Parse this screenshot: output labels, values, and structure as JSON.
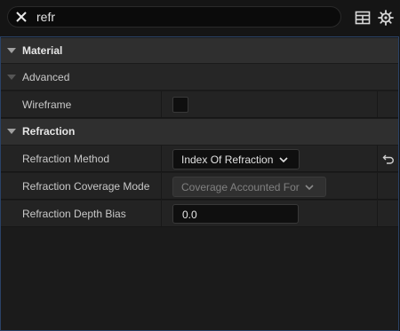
{
  "search": {
    "value": "refr"
  },
  "toolbar": {
    "view_options_icon": "table-grid-icon",
    "settings_icon": "gear-icon"
  },
  "categories": [
    {
      "label": "Material",
      "subcategory": {
        "label": "Advanced"
      },
      "properties": [
        {
          "name": "Wireframe",
          "type": "checkbox",
          "checked": false
        }
      ]
    },
    {
      "label": "Refraction",
      "properties": [
        {
          "name": "Refraction Method",
          "type": "dropdown",
          "value": "Index Of Refraction",
          "resettable": true
        },
        {
          "name": "Refraction Coverage Mode",
          "type": "dropdown",
          "value": "Coverage Accounted For",
          "disabled": true
        },
        {
          "name": "Refraction Depth Bias",
          "type": "number",
          "value": "0.0"
        }
      ]
    }
  ],
  "colors": {
    "background": "#151515",
    "panel_border": "#2a4266",
    "category_bg": "#2f2f2f",
    "row_bg": "#232323"
  }
}
